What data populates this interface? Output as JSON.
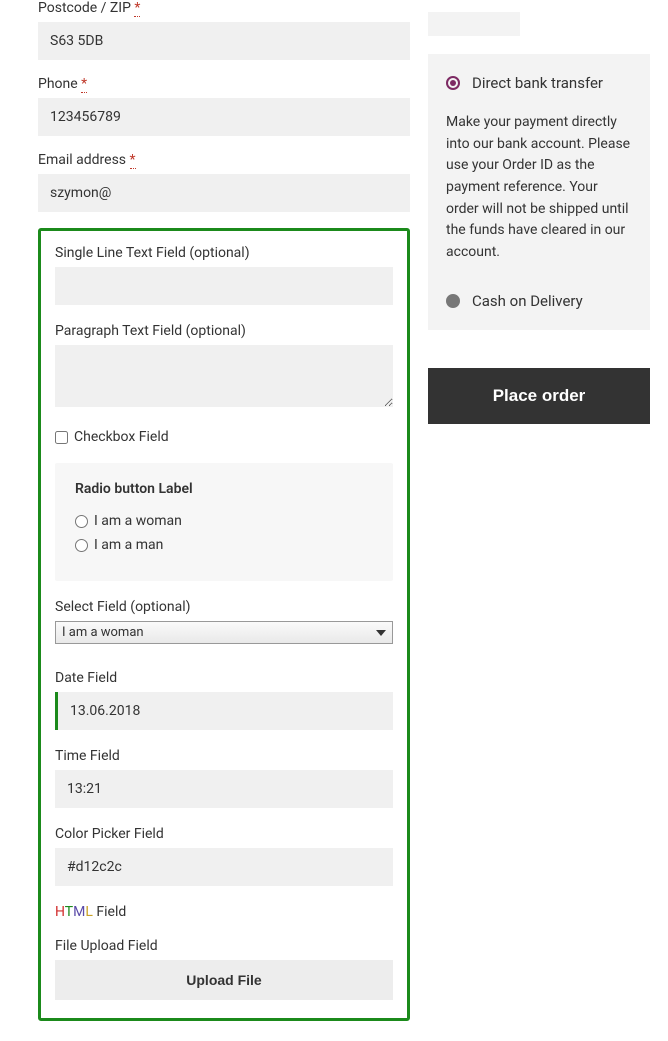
{
  "billing": {
    "postcode_label": "Postcode / ZIP",
    "postcode_value": "S63 5DB",
    "phone_label": "Phone",
    "phone_value": "123456789",
    "email_label": "Email address",
    "email_value": "szymon@",
    "required_mark": "*"
  },
  "custom": {
    "single_line_label": "Single Line Text Field (optional)",
    "single_line_value": "",
    "paragraph_label": "Paragraph Text Field (optional)",
    "paragraph_value": "",
    "checkbox_label": "Checkbox Field",
    "radio_title": "Radio button Label",
    "radio_opt1": "I am a woman",
    "radio_opt2": "I am a man",
    "select_label": "Select Field (optional)",
    "select_value": "I am a woman",
    "date_label": "Date Field",
    "date_value": "13.06.2018",
    "time_label": "Time Field",
    "time_value": "13:21",
    "color_label": "Color Picker Field",
    "color_value": "#d12c2c",
    "html_label_suffix": " Field",
    "file_label": "File Upload Field",
    "upload_button": "Upload File"
  },
  "payment": {
    "opt1_label": "Direct bank transfer",
    "opt1_desc": "Make your payment directly into our bank account. Please use your Order ID as the payment reference. Your order will not be shipped until the funds have cleared in our account.",
    "opt2_label": "Cash on Delivery",
    "place_order": "Place order"
  }
}
